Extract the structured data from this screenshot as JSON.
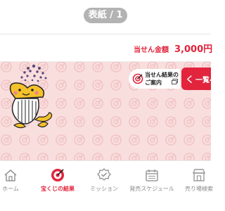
{
  "header": {
    "page_indicator": "表紙 / 1"
  },
  "summary": {
    "label": "当せん金額",
    "amount": "3,000円"
  },
  "canvas": {
    "guide_button": {
      "line1": "当せん結果の",
      "line2": "ご案内"
    },
    "list_button": {
      "chevron": "く",
      "label": "一覧へ"
    }
  },
  "tabs": [
    {
      "label": "ホーム",
      "icon": "home-icon",
      "active": false
    },
    {
      "label": "宝くじの結果",
      "icon": "target-icon",
      "active": true
    },
    {
      "label": "ミッション",
      "icon": "check-badge-icon",
      "active": false
    },
    {
      "label": "発売スケジュール",
      "icon": "calendar-icon",
      "active": false
    },
    {
      "label": "売り場検索",
      "icon": "shop-icon",
      "active": false
    }
  ],
  "colors": {
    "accent": "#e2243c",
    "pink_bg": "#f9dede",
    "pill": "#b3b3b3"
  }
}
